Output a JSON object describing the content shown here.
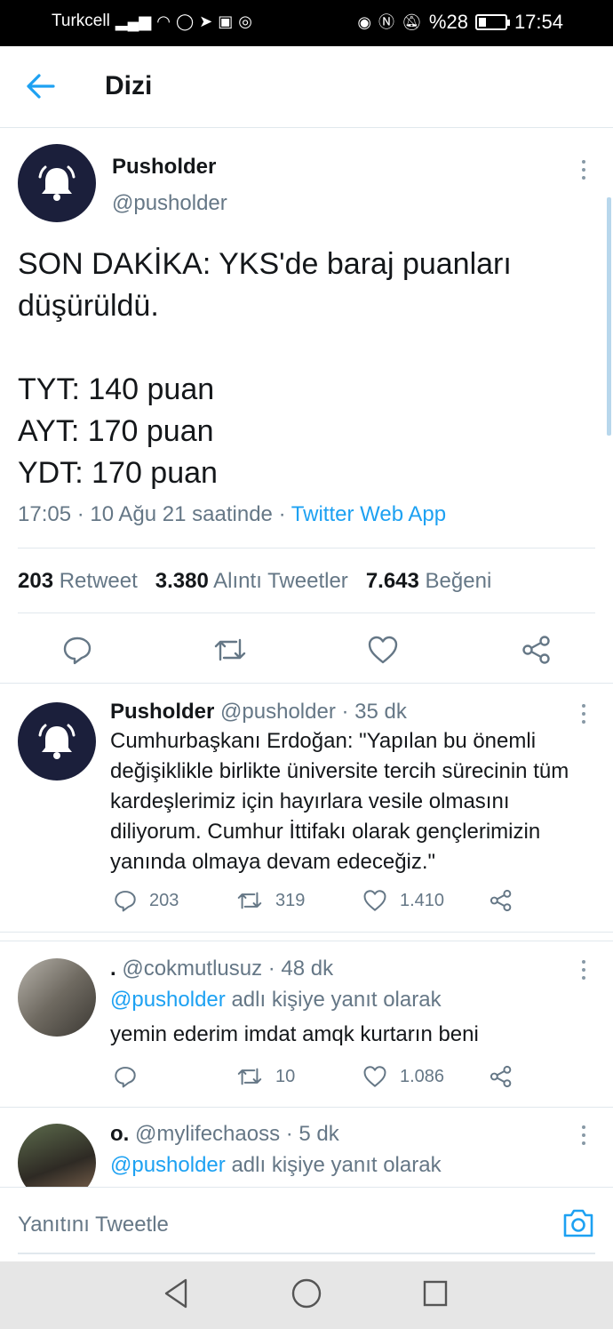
{
  "status_bar": {
    "carrier": "Turkcell",
    "battery": "%28",
    "battery_level": 0.28,
    "time": "17:54"
  },
  "header": {
    "title": "Dizi"
  },
  "main_tweet": {
    "name": "Pusholder",
    "handle": "@pusholder",
    "text": "SON DAKİKA: YKS'de baraj puanları düşürüldü.\n\nTYT: 140 puan\nAYT: 170 puan\nYDT: 170 puan",
    "timestamp": "17:05 · 10 Ağu 21 saatinde ·",
    "source": "Twitter Web App",
    "retweet_count": "203",
    "retweet_label": "Retweet",
    "quote_count": "3.380",
    "quote_label": "Alıntı Tweetler",
    "like_count": "7.643",
    "like_label": "Beğeni"
  },
  "replies": [
    {
      "name": "Pusholder",
      "handle": "@pusholder",
      "time": "· 35 dk",
      "text": "Cumhurbaşkanı Erdoğan: \"Yapılan bu önemli değişiklikle birlikte üniversite tercih sürecinin tüm kardeşlerimiz için hayırlara vesile olmasını diliyorum. Cumhur İttifakı olarak gençlerimizin yanında olmaya devam edeceğiz.\"",
      "reply_count": "203",
      "retweet_count": "319",
      "like_count": "1.410"
    },
    {
      "name": ".",
      "handle": "@cokmutlusuz",
      "time": "· 48 dk",
      "reply_to_mention": "@pusholder",
      "reply_to_suffix": "adlı kişiye yanıt olarak",
      "text": "yemin ederim imdat amqk kurtarın beni",
      "reply_count": "",
      "retweet_count": "10",
      "like_count": "1.086"
    },
    {
      "name": "o.",
      "handle": "@mylifechaoss",
      "time": "· 5 dk",
      "reply_to_mention": "@pusholder",
      "reply_to_suffix": "adlı kişiye yanıt olarak"
    }
  ],
  "compose": {
    "placeholder": "Yanıtını Tweetle"
  },
  "colors": {
    "accent": "#1da1f2",
    "avatar_bg": "#1b1f3b",
    "text_secondary": "#657786"
  }
}
